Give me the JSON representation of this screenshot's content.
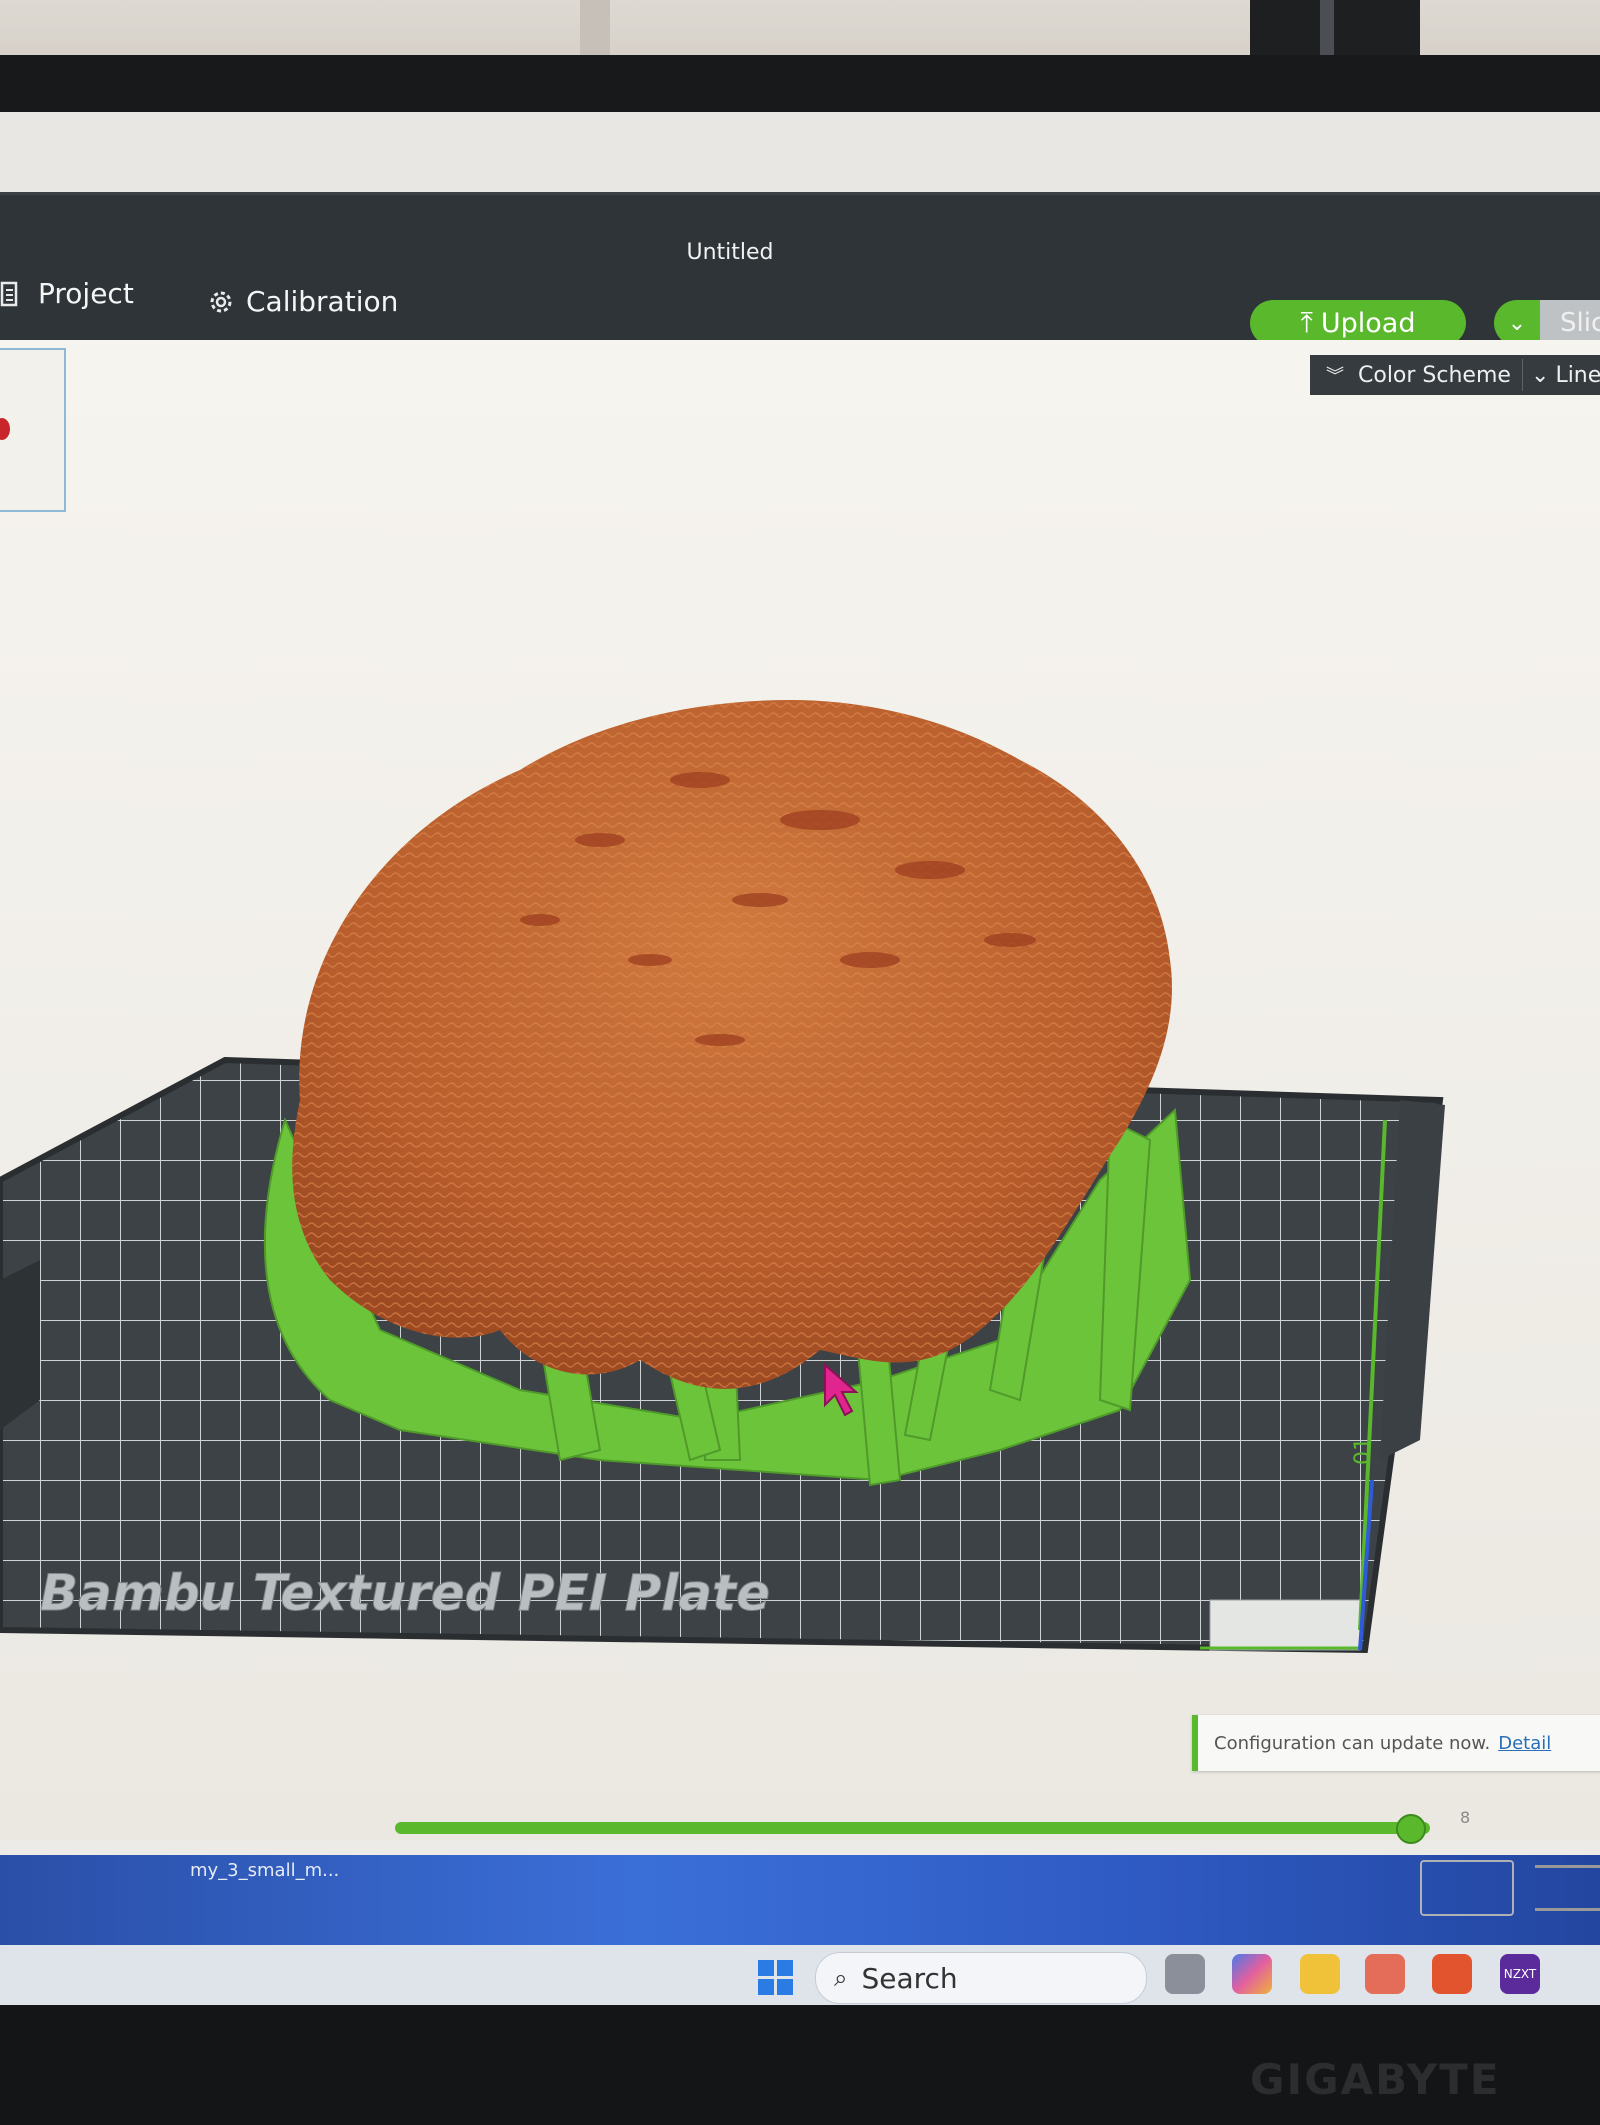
{
  "window": {
    "title": "Untitled"
  },
  "tabs": [
    {
      "label": "Project",
      "icon": "project-icon"
    },
    {
      "label": "Calibration",
      "icon": "calibration-gear-icon"
    }
  ],
  "toolbar": {
    "upload_label": "Upload",
    "slice_label": "Slic"
  },
  "viewport": {
    "color_scheme_label": "Color Scheme",
    "color_scheme_value": "Line",
    "plate_label": "Bambu Textured PEI Plate",
    "plate_number": "01"
  },
  "notification": {
    "text": "Configuration can update now.",
    "link": "Detail"
  },
  "layer_slider": {
    "value_label": "8",
    "position_fraction": 0.98
  },
  "desktop": {
    "file_label": "my_3_small_m..."
  },
  "taskbar": {
    "search_placeholder": "Search",
    "app_label": "NZXT"
  },
  "monitor": {
    "brand": "GIGABYTE"
  },
  "colors": {
    "accent": "#59b82c",
    "header": "#2f3438",
    "model_orange": "#c96a34",
    "support_green": "#6cc43a"
  }
}
